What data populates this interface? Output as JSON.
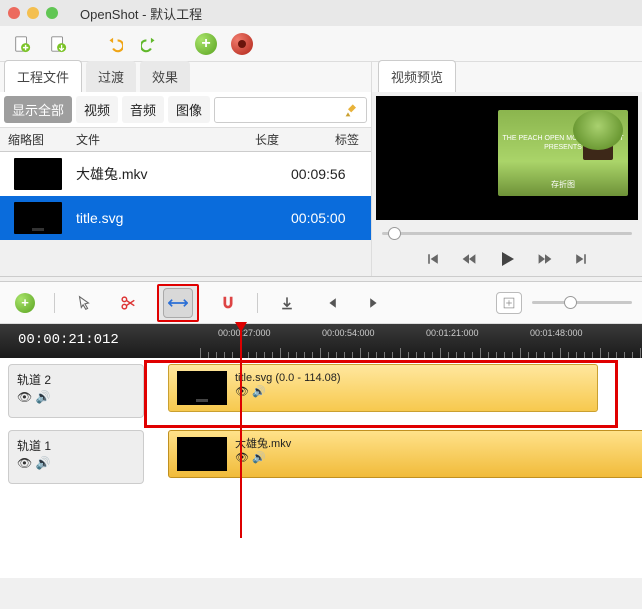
{
  "window": {
    "title": "OpenShot - 默认工程"
  },
  "colors": {
    "red": "#ec6a5e",
    "yellow": "#f4bf4f",
    "green": "#61c654",
    "add_green": "#7cc428",
    "record_red": "#d03a2b",
    "accent": "#0a6cdc",
    "highlight_red": "#e00000"
  },
  "tabs": {
    "project": "工程文件",
    "trans": "过渡",
    "effects": "效果",
    "preview": "视频预览"
  },
  "filters": {
    "all": "显示全部",
    "video": "视频",
    "audio": "音频",
    "image": "图像"
  },
  "columns": {
    "thumb": "缩略图",
    "file": "文件",
    "length": "长度",
    "tags": "标签"
  },
  "files": [
    {
      "name": "大雄兔.mkv",
      "length": "00:09:56",
      "selected": false
    },
    {
      "name": "title.svg",
      "length": "00:05:00",
      "selected": true
    }
  ],
  "preview": {
    "caption1": "THE PEACH OPEN MOVIE PROJECT",
    "caption2": "PRESENTS",
    "subs": "存折图"
  },
  "timeline": {
    "timecode": "00:00:21:012",
    "marks": [
      "00:00:27:000",
      "00:00:54:000",
      "00:01:21:000",
      "00:01:48:000"
    ],
    "track2_label": "轨道 2",
    "track1_label": "轨道 1"
  },
  "clips": {
    "c1": {
      "title": "title.svg (0.0 - 114.08)"
    },
    "c2": {
      "title": "大雄兔.mkv"
    }
  }
}
